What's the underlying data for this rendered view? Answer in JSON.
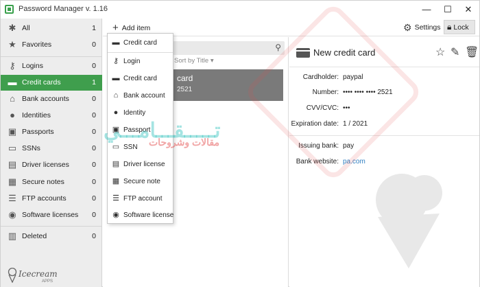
{
  "app": {
    "title": "Password Manager v. 1.16",
    "window_controls": {
      "minimize": "—",
      "maximize": "☐",
      "close": "✕"
    }
  },
  "toolbar": {
    "add_item": "Add item",
    "settings": "Settings",
    "lock": "Lock"
  },
  "sidebar": {
    "items": [
      {
        "label": "All",
        "count": "1",
        "icon": "asterisk-icon"
      },
      {
        "label": "Favorites",
        "count": "0",
        "icon": "star-icon"
      },
      {
        "label": "Logins",
        "count": "0",
        "icon": "key-icon"
      },
      {
        "label": "Credit cards",
        "count": "1",
        "icon": "credit-card-icon",
        "active": true
      },
      {
        "label": "Bank accounts",
        "count": "0",
        "icon": "bank-icon"
      },
      {
        "label": "Identities",
        "count": "0",
        "icon": "person-icon"
      },
      {
        "label": "Passports",
        "count": "0",
        "icon": "passport-icon"
      },
      {
        "label": "SSNs",
        "count": "0",
        "icon": "ssn-icon"
      },
      {
        "label": "Driver licenses",
        "count": "0",
        "icon": "license-icon"
      },
      {
        "label": "Secure notes",
        "count": "0",
        "icon": "note-icon"
      },
      {
        "label": "FTP accounts",
        "count": "0",
        "icon": "database-icon"
      },
      {
        "label": "Software licenses",
        "count": "0",
        "icon": "disc-icon"
      },
      {
        "label": "Deleted",
        "count": "0",
        "icon": "trash-icon"
      }
    ],
    "brand": {
      "name": "Icecream",
      "sub": "APPS"
    }
  },
  "add_menu": {
    "items": [
      {
        "label": "Credit card",
        "icon": "credit-card-icon"
      },
      {
        "label": "Login",
        "icon": "key-icon"
      },
      {
        "label": "Credit card",
        "icon": "credit-card-icon"
      },
      {
        "label": "Bank account",
        "icon": "bank-icon"
      },
      {
        "label": "Identity",
        "icon": "person-icon"
      },
      {
        "label": "Passport",
        "icon": "passport-icon"
      },
      {
        "label": "SSN",
        "icon": "ssn-icon"
      },
      {
        "label": "Driver license",
        "icon": "license-icon"
      },
      {
        "label": "Secure note",
        "icon": "note-icon"
      },
      {
        "label": "FTP account",
        "icon": "database-icon"
      },
      {
        "label": "Software license",
        "icon": "disc-icon"
      }
    ]
  },
  "list": {
    "sort_label": "Sort by Title",
    "items": [
      {
        "name": "card",
        "number": "2521"
      }
    ]
  },
  "detail": {
    "title": "New credit card",
    "fields": [
      {
        "label": "Cardholder:",
        "value": "paypal"
      },
      {
        "label": "Number:",
        "value": "•••• •••• •••• 2521"
      },
      {
        "label": "CVV/CVC:",
        "value": "•••"
      },
      {
        "label": "Expiration date:",
        "value": "1 / 2021"
      }
    ],
    "extra_fields": [
      {
        "label": "Issuing bank:",
        "value": "pay"
      },
      {
        "label": "Bank website:",
        "value": "pa.com",
        "link": true
      }
    ]
  },
  "watermark": {
    "line1": "تـــــقـــامـــي",
    "line2": "مقالات وشروحات"
  }
}
